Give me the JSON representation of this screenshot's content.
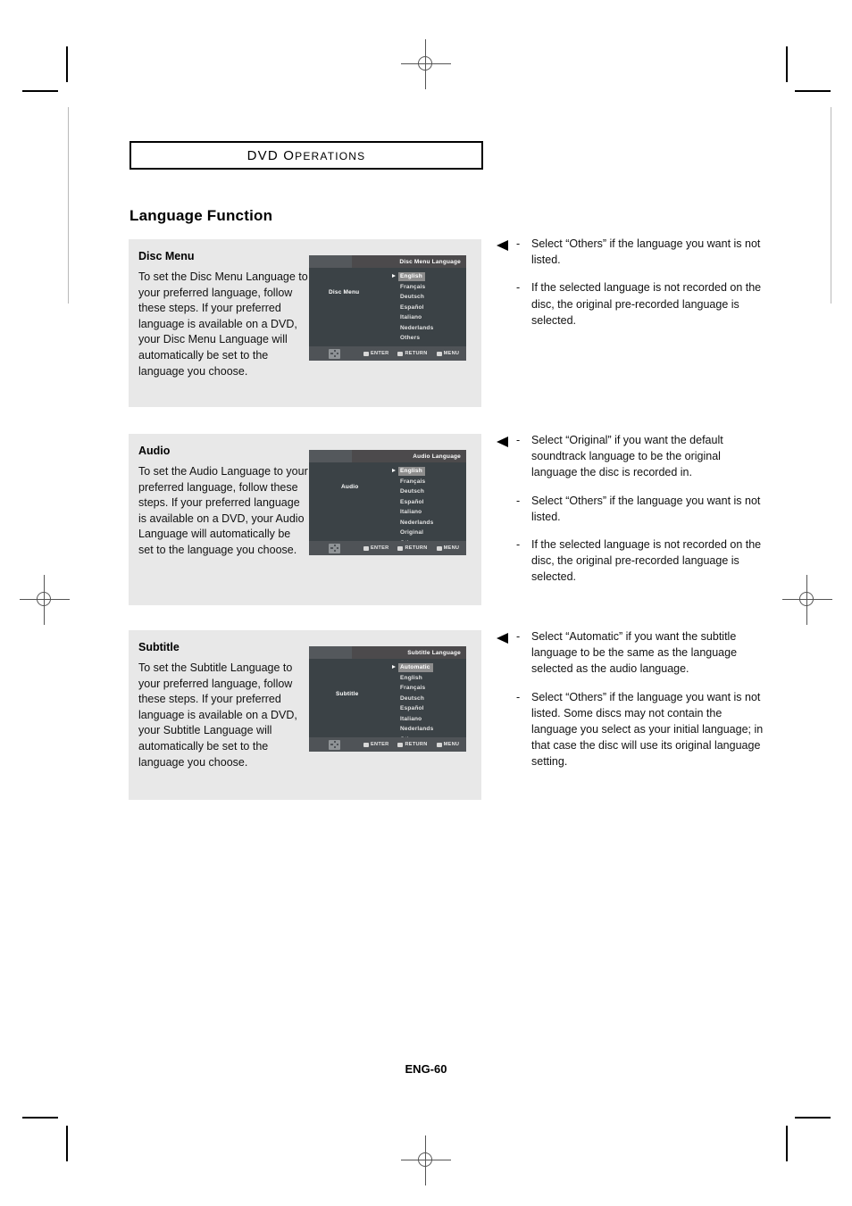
{
  "header": {
    "section_label_main": "DVD",
    "section_label_rest": "PERATIONS",
    "section_label_cap": "O",
    "page_title": "Language Function"
  },
  "footer": {
    "page_number": "ENG-60"
  },
  "colors": {
    "panel_background": "#e8e8e8",
    "osd_background": "#3b4246",
    "osd_topbar_left": "#54585c",
    "osd_topbar_right": "#4c4a4c",
    "osd_bottombar": "#4f5357",
    "osd_highlight": "#8d8d8d",
    "page_background": "#ffffff",
    "text": "#000000"
  },
  "panels": [
    {
      "heading": "Disc Menu",
      "paragraph": "To set the Disc Menu Language to your preferred language, follow these steps. If your preferred language is available on a DVD, your Disc Menu Language will automatically be set to the language you choose.",
      "osd": {
        "title": "Disc Menu Language",
        "side_label": "Disc Menu",
        "items": [
          {
            "label": "English",
            "selected": true
          },
          {
            "label": "Français",
            "selected": false
          },
          {
            "label": "Deutsch",
            "selected": false
          },
          {
            "label": "Español",
            "selected": false
          },
          {
            "label": "Italiano",
            "selected": false
          },
          {
            "label": "Nederlands",
            "selected": false
          },
          {
            "label": "Others",
            "selected": false
          }
        ],
        "hints": [
          {
            "icon": "dpad-icon",
            "label": ""
          },
          {
            "icon": "key-glyph",
            "label": "ENTER"
          },
          {
            "icon": "key-glyph",
            "label": "RETURN"
          },
          {
            "icon": "key-glyph",
            "label": "MENU"
          }
        ]
      }
    },
    {
      "heading": "Audio",
      "paragraph": "To set the Audio Language to your preferred language, follow these steps. If your preferred language is available on a DVD, your Audio Language will automatically be set to the language you choose.",
      "osd": {
        "title": "Audio Language",
        "side_label": "Audio",
        "items": [
          {
            "label": "English",
            "selected": true
          },
          {
            "label": "Français",
            "selected": false
          },
          {
            "label": "Deutsch",
            "selected": false
          },
          {
            "label": "Español",
            "selected": false
          },
          {
            "label": "Italiano",
            "selected": false
          },
          {
            "label": "Nederlands",
            "selected": false
          },
          {
            "label": "Original",
            "selected": false
          },
          {
            "label": "Others",
            "selected": false
          }
        ],
        "hints": [
          {
            "icon": "dpad-icon",
            "label": ""
          },
          {
            "icon": "key-glyph",
            "label": "ENTER"
          },
          {
            "icon": "key-glyph",
            "label": "RETURN"
          },
          {
            "icon": "key-glyph",
            "label": "MENU"
          }
        ]
      }
    },
    {
      "heading": "Subtitle",
      "paragraph": "To set the Subtitle Language to your preferred language, follow these steps. If your preferred language is available on a DVD, your Subtitle Language will automatically be set to the language you choose.",
      "osd": {
        "title": "Subtitle Language",
        "side_label": "Subtitle",
        "items": [
          {
            "label": "Automatic",
            "selected": true
          },
          {
            "label": "English",
            "selected": false
          },
          {
            "label": "Français",
            "selected": false
          },
          {
            "label": "Deutsch",
            "selected": false
          },
          {
            "label": "Español",
            "selected": false
          },
          {
            "label": "Italiano",
            "selected": false
          },
          {
            "label": "Nederlands",
            "selected": false
          },
          {
            "label": "Others",
            "selected": false
          }
        ],
        "hints": [
          {
            "icon": "dpad-icon",
            "label": ""
          },
          {
            "icon": "key-glyph",
            "label": "ENTER"
          },
          {
            "icon": "key-glyph",
            "label": "RETURN"
          },
          {
            "icon": "key-glyph",
            "label": "MENU"
          }
        ]
      }
    }
  ],
  "note_groups": [
    {
      "notes": [
        {
          "marker": "triangle",
          "dash": "-",
          "text": "Select “Others” if the language you want is not listed."
        },
        {
          "marker": "none",
          "dash": "-",
          "text": "If the selected language is not recorded on the disc, the original pre-recorded language is selected."
        }
      ]
    },
    {
      "notes": [
        {
          "marker": "triangle",
          "dash": "-",
          "text": "Select “Original” if you want the default soundtrack language to be the original language the disc is recorded in."
        },
        {
          "marker": "none",
          "dash": "-",
          "text": "Select “Others” if the language you want is not listed."
        },
        {
          "marker": "none",
          "dash": "-",
          "text": "If the selected language is not recorded on the disc, the original pre-recorded language is selected."
        }
      ]
    },
    {
      "notes": [
        {
          "marker": "triangle",
          "dash": "-",
          "text": "Select “Automatic” if you want the subtitle language to be the same as the language selected as the audio language."
        },
        {
          "marker": "none",
          "dash": "-",
          "text": "Select “Others” if the language you want is not listed. Some discs may not contain the language you select as your initial language; in that case the disc will use its original language setting."
        }
      ]
    }
  ]
}
